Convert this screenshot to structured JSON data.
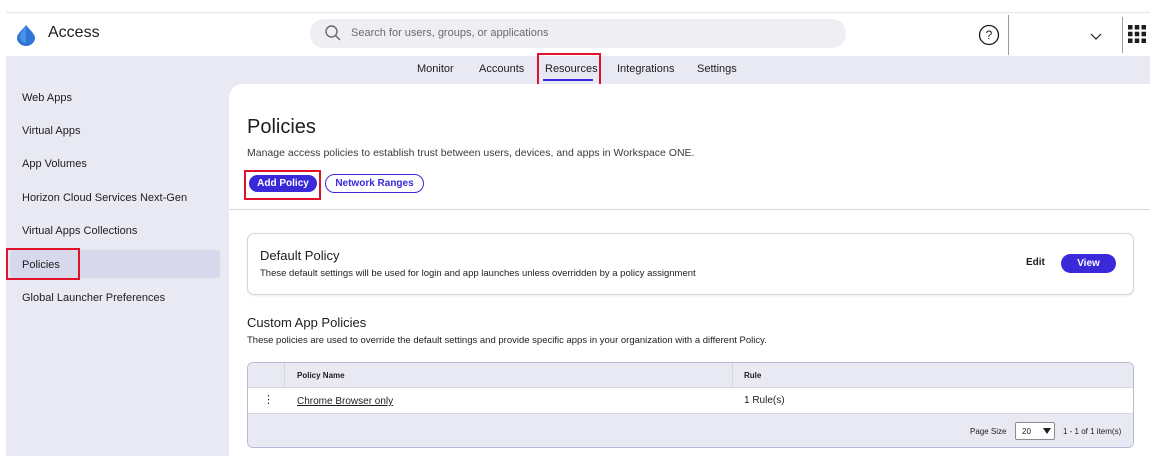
{
  "app": {
    "title": "Access"
  },
  "search": {
    "placeholder": "Search for users, groups, or applications"
  },
  "colors": {
    "accent": "#3a29d9",
    "highlight_box": "#e0112a",
    "panel_bg": "#e9e9f4"
  },
  "icons": {
    "logo": "drop-logo-icon",
    "search": "search-icon",
    "help": "help-icon",
    "user_menu": "chevron-down-icon",
    "apps": "app-grid-icon",
    "row_menu": "kebab-icon",
    "page_size": "caret-down-icon"
  },
  "tabs": [
    {
      "label": "Monitor"
    },
    {
      "label": "Accounts"
    },
    {
      "label": "Resources",
      "active": true
    },
    {
      "label": "Integrations"
    },
    {
      "label": "Settings"
    }
  ],
  "sidebar": {
    "items": [
      {
        "label": "Web Apps"
      },
      {
        "label": "Virtual Apps"
      },
      {
        "label": "App Volumes"
      },
      {
        "label": "Horizon Cloud Services Next-Gen"
      },
      {
        "label": "Virtual Apps Collections"
      },
      {
        "label": "Policies",
        "active": true
      },
      {
        "label": "Global Launcher Preferences"
      }
    ]
  },
  "page": {
    "title": "Policies",
    "description": "Manage access policies to establish trust between users, devices, and apps in Workspace ONE.",
    "add_policy_label": "Add Policy",
    "network_ranges_label": "Network Ranges"
  },
  "default_policy": {
    "title": "Default Policy",
    "description": "These default settings will be used for login and app launches unless overridden by a policy assignment",
    "edit_label": "Edit",
    "view_label": "View"
  },
  "custom_policies": {
    "title": "Custom App Policies",
    "description": "These policies are used to override the default settings and provide specific apps in your organization with a different Policy.",
    "columns": [
      "Policy Name",
      "Rule"
    ],
    "rows": [
      {
        "kebab": "⋮",
        "name": "Chrome Browser only",
        "rule": "1 Rule(s)"
      }
    ],
    "footer": {
      "page_size_label": "Page Size",
      "page_size_value": "20",
      "count_text": "1 - 1 of 1 item(s)"
    }
  }
}
